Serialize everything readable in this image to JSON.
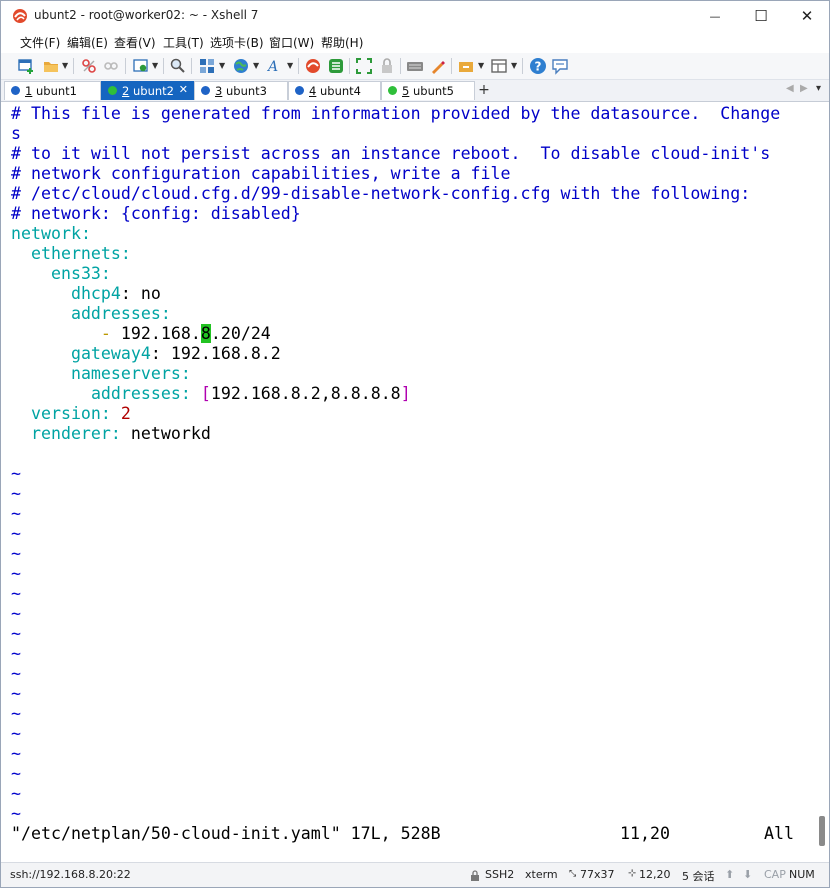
{
  "window": {
    "title": "ubunt2 - root@worker02: ~ - Xshell 7",
    "minimize_glyph": "—",
    "maximize_glyph": "☐",
    "close_glyph": "✕"
  },
  "menu": [
    "文件(F)",
    "编辑(E)",
    "查看(V)",
    "工具(T)",
    "选项卡(B)",
    "窗口(W)",
    "帮助(H)"
  ],
  "toolbar_icons": [
    "new-session-icon",
    "open-folder-icon",
    "disconnect-icon",
    "reconnect-icon",
    "properties-icon",
    "find-icon",
    "layout-icon",
    "globe-icon",
    "font-icon",
    "xshell-icon",
    "xftp-icon",
    "fullscreen-icon",
    "lock-icon",
    "keyboard-icon",
    "pen-icon",
    "script-icon",
    "transfer-icon",
    "help-icon",
    "chat-icon"
  ],
  "tabs": [
    {
      "num": "1",
      "name": " ubunt1",
      "status": "error",
      "active": false
    },
    {
      "num": "2",
      "name": " ubunt2",
      "status": "connected",
      "active": true
    },
    {
      "num": "3",
      "name": " ubunt3",
      "status": "error",
      "active": false
    },
    {
      "num": "4",
      "name": " ubunt4",
      "status": "error",
      "active": false
    },
    {
      "num": "5",
      "name": " ubunt5",
      "status": "connected",
      "active": false
    }
  ],
  "tab_add": "+",
  "tab_nav": {
    "prev": "◀",
    "next": "▶",
    "menu": "▾"
  },
  "terminal": {
    "comments": [
      "# This file is generated from information provided by the datasource.  Change",
      "s",
      "# to it will not persist across an instance reboot.  To disable cloud-init's",
      "# network configuration capabilities, write a file",
      "# /etc/cloud/cloud.cfg.d/99-disable-network-config.cfg with the following:",
      "# network: {config: disabled}"
    ],
    "k_network": "network",
    "k_ethernets": "ethernets",
    "k_ens33": "ens33",
    "k_dhcp4": "dhcp4",
    "v_dhcp4": "no",
    "k_addresses": "addresses",
    "addr_dash": "-",
    "addr_pre": "192.168.",
    "addr_cursor": "8",
    "addr_post": ".20/24",
    "k_gateway4": "gateway4",
    "v_gateway4": "192.168.8.2",
    "k_nameservers": "nameservers",
    "k_ns_addresses": "addresses",
    "ns_open": "[",
    "ns_value": "192.168.8.2,8.8.8.8",
    "ns_close": "]",
    "k_version": "version",
    "v_version": "2",
    "k_renderer": "renderer",
    "v_renderer": "networkd",
    "colon": ":",
    "tilde": "~",
    "tilde_count": 18,
    "vim_file": "\"/etc/netplan/50-cloud-init.yaml\" 17L, 528B",
    "vim_pos": "11,20",
    "vim_scroll": "All"
  },
  "status": {
    "address": "ssh://192.168.8.20:22",
    "protocol": "SSH2",
    "term_type": "xterm",
    "size": "77x37",
    "cursor": "12,20",
    "sessions": "5 会话",
    "caps": "CAP",
    "num": "NUM"
  },
  "colors": {
    "accent": "#1565c0",
    "comment": "#0000c8",
    "key": "#00a3a3",
    "cursor": "#22c322"
  }
}
